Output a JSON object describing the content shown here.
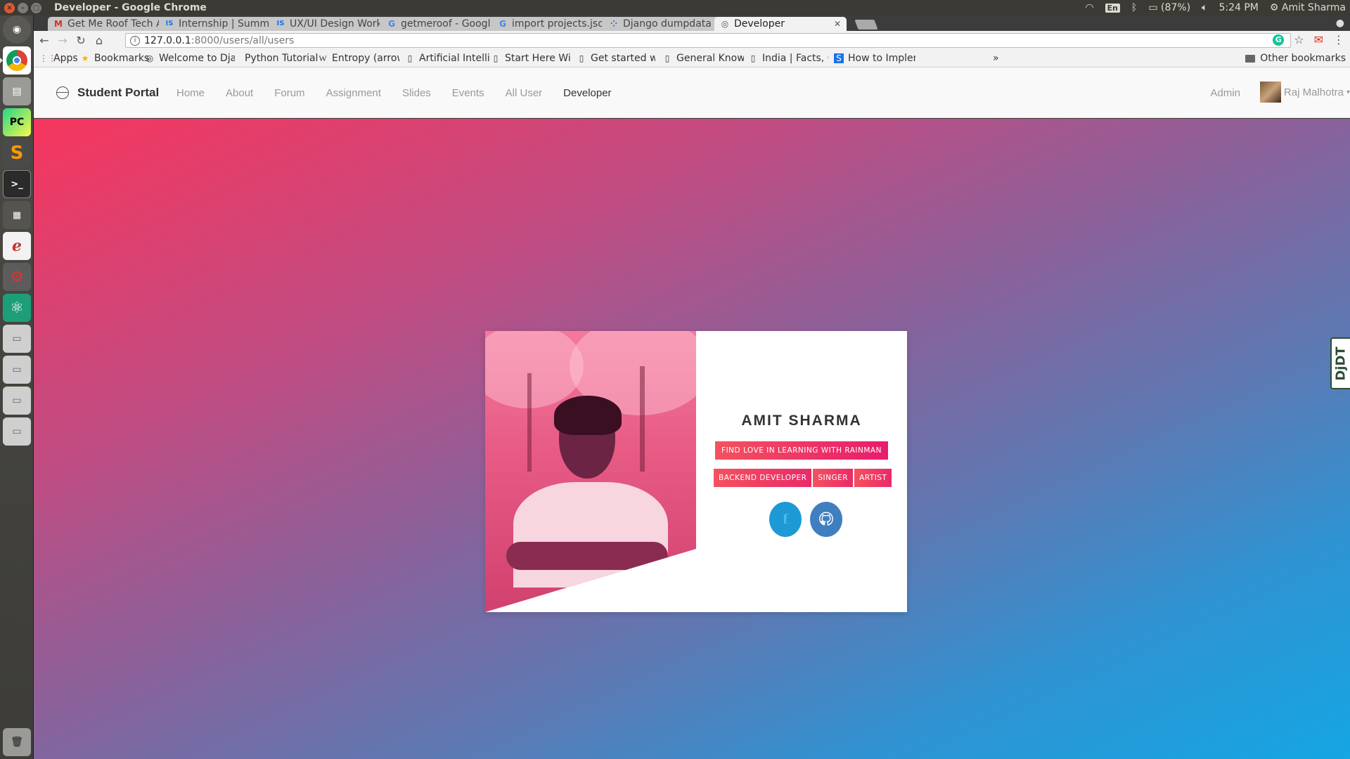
{
  "window": {
    "title": "Developer - Google Chrome"
  },
  "system_tray": {
    "keyboard": "En",
    "battery": "(87%)",
    "time": "5:24 PM",
    "user": "Amit Sharma"
  },
  "tabs": [
    {
      "label": "Get Me Roof Tech A",
      "icon": "gmail-icon",
      "glyph": "M"
    },
    {
      "label": "Internship | Summe",
      "icon": "is-icon",
      "glyph": "IS"
    },
    {
      "label": "UX/UI Design Work",
      "icon": "is-icon",
      "glyph": "IS"
    },
    {
      "label": "getmeroof - Google",
      "icon": "google-icon",
      "glyph": "G"
    },
    {
      "label": "import projects.jso",
      "icon": "google-icon",
      "glyph": "G"
    },
    {
      "label": "Django dumpdata",
      "icon": "dots-icon",
      "glyph": "⁘"
    },
    {
      "label": "Developer",
      "icon": "globe-icon",
      "glyph": "◎"
    }
  ],
  "omnibox": {
    "host": "127.0.0.1",
    "path": ":8000/users/all/users"
  },
  "bookmarks": {
    "items": [
      {
        "label": "Apps",
        "glyph": "⋮⋮"
      },
      {
        "label": "Bookmarks",
        "glyph": "★"
      },
      {
        "label": "Welcome to Djar",
        "glyph": "◎"
      },
      {
        "label": "Python Tutorial:",
        "glyph": ""
      },
      {
        "label": "Entropy (arrow c",
        "glyph": "W"
      },
      {
        "label": "Artificial Intellig",
        "glyph": "▯"
      },
      {
        "label": "Start Here With",
        "glyph": "▯"
      },
      {
        "label": "Get started with",
        "glyph": "▯"
      },
      {
        "label": "General Knowlec",
        "glyph": "▯"
      },
      {
        "label": "India | Facts, Cul",
        "glyph": "▯"
      },
      {
        "label": "How to Impleme",
        "glyph": "S"
      }
    ],
    "overflow": "»",
    "other": "Other bookmarks"
  },
  "site": {
    "brand": "Student Portal",
    "nav": [
      "Home",
      "About",
      "Forum",
      "Assignment",
      "Slides",
      "Events",
      "All User",
      "Developer"
    ],
    "active_nav": "Developer",
    "admin": "Admin",
    "user": "Raj Malhotra"
  },
  "debug_toolbar": {
    "label": "DjDT"
  },
  "profile": {
    "name": "AMIT SHARMA",
    "motto": "FIND LOVE IN LEARNING WITH RAINMAN",
    "tags": [
      "BACKEND DEVELOPER",
      "SINGER",
      "ARTIST"
    ],
    "socials": [
      {
        "name": "facebook",
        "glyph": "f"
      },
      {
        "name": "github",
        "glyph": "☉"
      }
    ]
  },
  "colors": {
    "gradient_start": "#f6365e",
    "gradient_end": "#15a6e3",
    "tag_start": "#f5515f",
    "tag_end": "#e81c6d"
  }
}
